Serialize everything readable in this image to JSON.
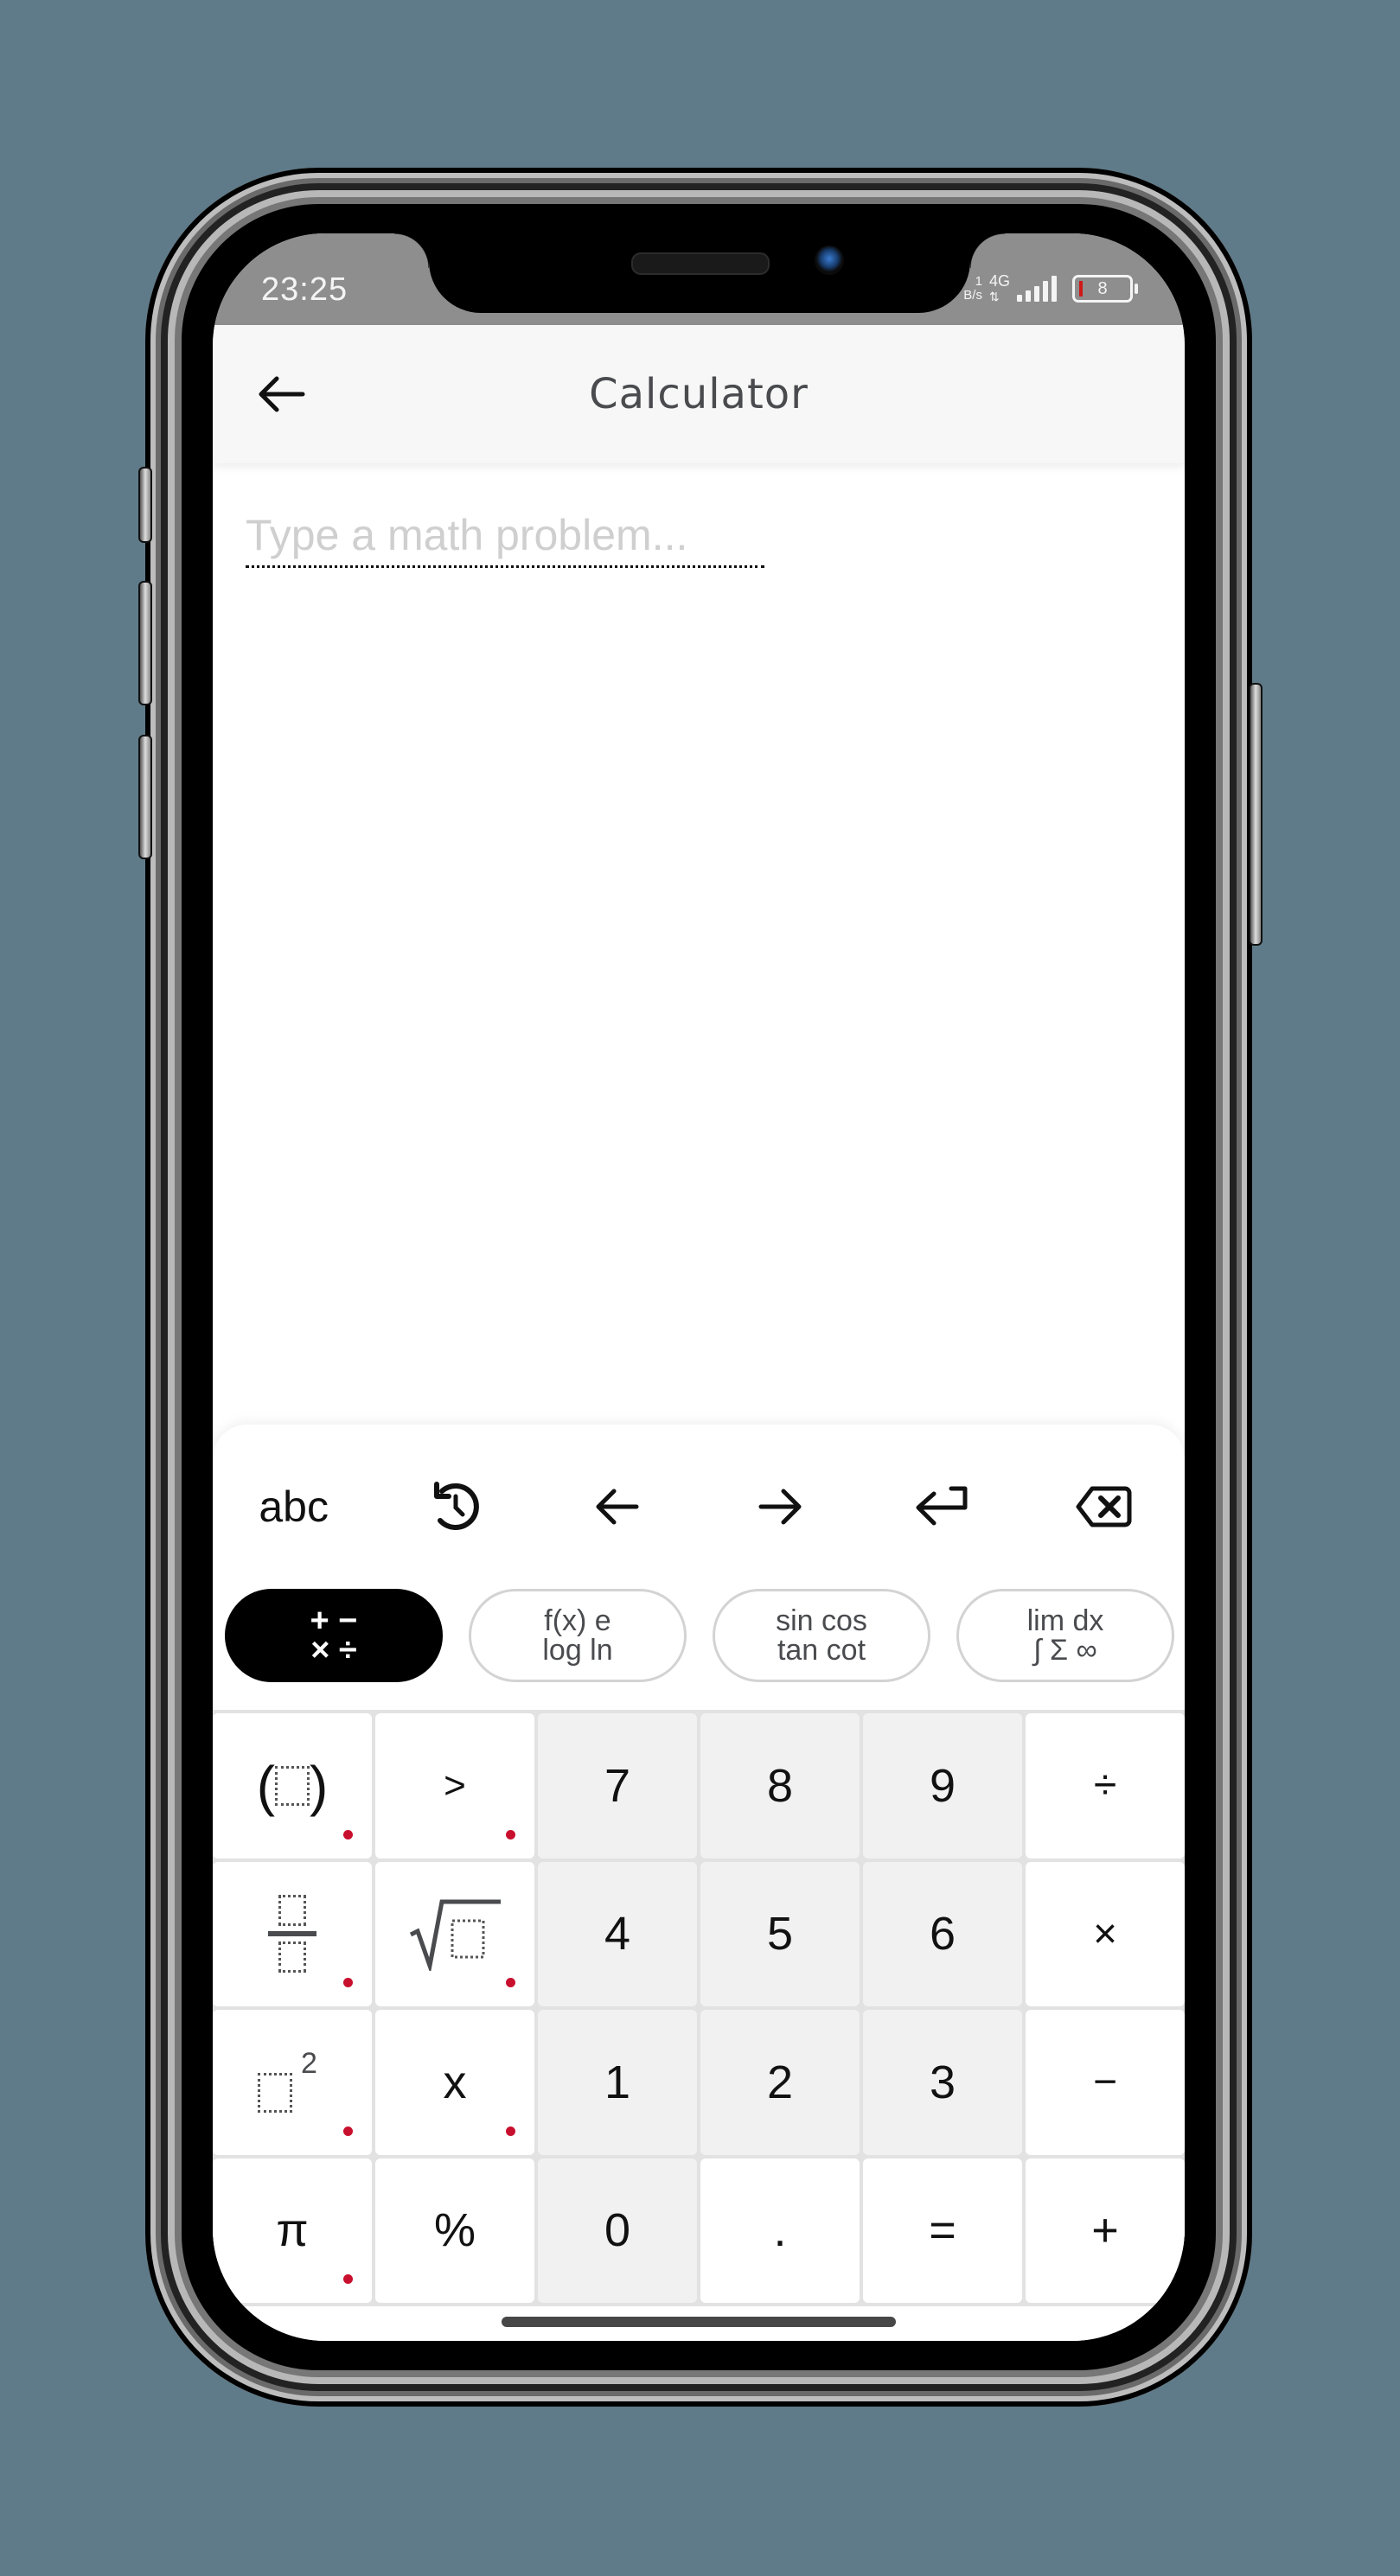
{
  "status_bar": {
    "time": "23:25",
    "net_speed_top": "1",
    "net_speed_unit": "B/s",
    "network_type": "4G",
    "battery_level": "8",
    "battery_low_color": "#d01818"
  },
  "app_bar": {
    "title": "Calculator",
    "back_icon": "arrow-left-icon"
  },
  "input": {
    "value": "",
    "placeholder": "Type a math problem..."
  },
  "keyboard": {
    "toolbar": [
      {
        "name": "abc-button",
        "label": "abc"
      },
      {
        "name": "history-button",
        "icon": "history-icon"
      },
      {
        "name": "cursor-left-button",
        "icon": "arrow-left-icon"
      },
      {
        "name": "cursor-right-button",
        "icon": "arrow-right-icon"
      },
      {
        "name": "enter-button",
        "icon": "enter-icon"
      },
      {
        "name": "backspace-button",
        "icon": "backspace-icon"
      }
    ],
    "modes": [
      {
        "line1": "+ −",
        "line2": "× ÷",
        "active": true
      },
      {
        "line1": "f(x)  e",
        "line2": "log  ln",
        "active": false
      },
      {
        "line1": "sin cos",
        "line2": "tan cot",
        "active": false
      },
      {
        "line1": "lim  dx",
        "line2": "∫ Σ ∞",
        "active": false
      }
    ],
    "keys": {
      "parens": "( )",
      "greater": ">",
      "fraction": "fraction",
      "sqrt": "√",
      "square_exp": "2",
      "var_x": "x",
      "pi": "π",
      "percent": "%",
      "d7": "7",
      "d8": "8",
      "d9": "9",
      "divide": "÷",
      "d4": "4",
      "d5": "5",
      "d6": "6",
      "multiply": "×",
      "d1": "1",
      "d2": "2",
      "d3": "3",
      "minus": "−",
      "d0": "0",
      "dot": ".",
      "equals": "=",
      "plus": "+"
    },
    "accent_dot_color": "#c8102e"
  }
}
